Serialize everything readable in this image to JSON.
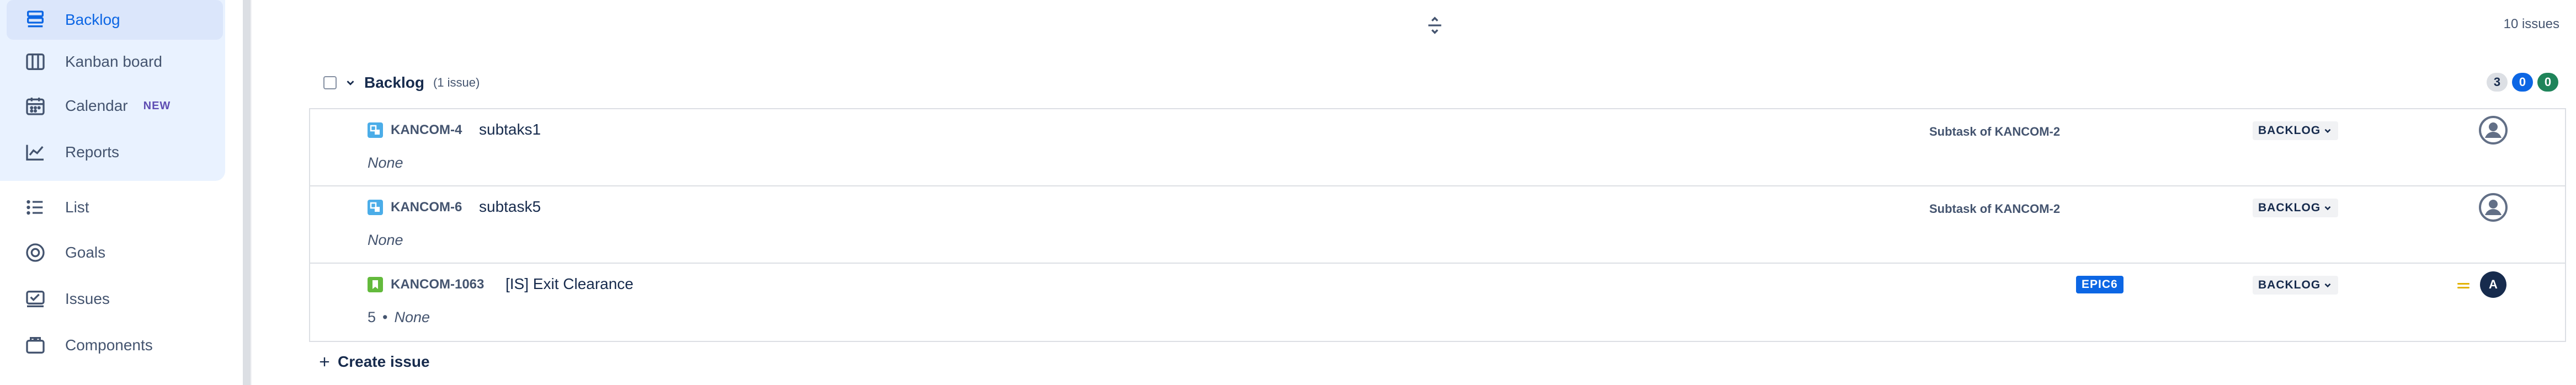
{
  "sidebar": {
    "items": [
      {
        "label": "Backlog",
        "icon": "backlog-icon"
      },
      {
        "label": "Kanban board",
        "icon": "board-icon"
      },
      {
        "label": "Calendar",
        "icon": "calendar-icon",
        "badge": "NEW"
      },
      {
        "label": "Reports",
        "icon": "reports-icon"
      },
      {
        "label": "List",
        "icon": "list-icon"
      },
      {
        "label": "Goals",
        "icon": "goals-icon"
      },
      {
        "label": "Issues",
        "icon": "issues-icon"
      },
      {
        "label": "Components",
        "icon": "components-icon"
      }
    ],
    "active_item": "Backlog"
  },
  "main": {
    "issue_count": "10 issues",
    "backlog": {
      "title": "Backlog",
      "subtitle": "(1 issue)",
      "counts": {
        "todo": "3",
        "in_progress": "0",
        "done": "0"
      }
    },
    "issues": [
      {
        "key": "KANCOM-4",
        "summary": "subtaks1",
        "type": "subtask",
        "parent": "Subtask of KANCOM-2",
        "status": "BACKLOG",
        "sub": "None",
        "estimate": "",
        "epic": "",
        "priority": "",
        "avatar": ""
      },
      {
        "key": "KANCOM-6",
        "summary": "subtask5",
        "type": "subtask",
        "parent": "Subtask of KANCOM-2",
        "status": "BACKLOG",
        "sub": "None",
        "estimate": "",
        "epic": "",
        "priority": "",
        "avatar": ""
      },
      {
        "key": "KANCOM-1063",
        "summary": "[IS] Exit Clearance",
        "type": "story",
        "parent": "",
        "status": "BACKLOG",
        "sub": "None",
        "estimate": "5",
        "epic": "EPIC6",
        "priority": "medium",
        "avatar": "A"
      }
    ],
    "create_issue_label": "Create issue"
  },
  "colors": {
    "accent": "#0c66e4",
    "sidebar_active_bg": "#e9f2ff",
    "epic_bg": "#0c66e4",
    "done_pill": "#1f845a",
    "priority_medium": "#e2b203"
  }
}
